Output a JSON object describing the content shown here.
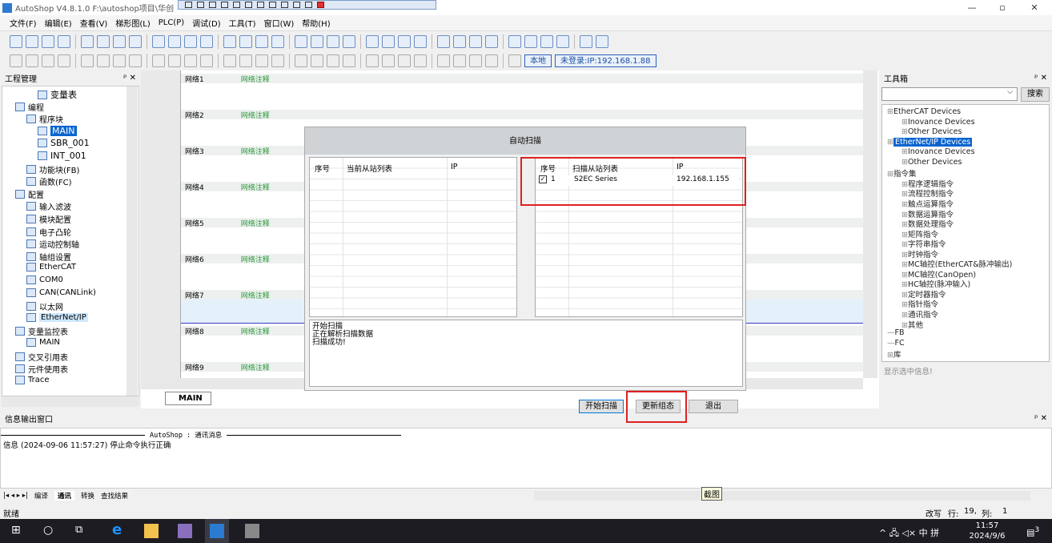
{
  "titlebar": {
    "title": "AutoShop V4.8.1.0  F:\\autoshop项目\\华创",
    "minimize": "—",
    "maximize": "▫",
    "close": "✕"
  },
  "menu": [
    "文件(F)",
    "编辑(E)",
    "查看(V)",
    "梯形图(L)",
    "PLC(P)",
    "调试(D)",
    "工具(T)",
    "窗口(W)",
    "帮助(H)"
  ],
  "toolbar": {
    "local_label": "本地",
    "login_label": "未登录:IP:192.168.1.88"
  },
  "left_panel": {
    "title": "工程管理",
    "items": [
      {
        "label": "变量表",
        "indent": 4
      },
      {
        "label": "编程",
        "indent": 2
      },
      {
        "label": "程序块",
        "indent": 3
      },
      {
        "label": "MAIN",
        "indent": 4,
        "selected": true
      },
      {
        "label": "SBR_001",
        "indent": 4
      },
      {
        "label": "INT_001",
        "indent": 4
      },
      {
        "label": "功能块(FB)",
        "indent": 3
      },
      {
        "label": "函数(FC)",
        "indent": 3
      },
      {
        "label": "配置",
        "indent": 2
      },
      {
        "label": "输入滤波",
        "indent": 3
      },
      {
        "label": "模块配置",
        "indent": 3
      },
      {
        "label": "电子凸轮",
        "indent": 3
      },
      {
        "label": "运动控制轴",
        "indent": 3
      },
      {
        "label": "轴组设置",
        "indent": 3
      },
      {
        "label": "EtherCAT",
        "indent": 3
      },
      {
        "label": "COM0",
        "indent": 3
      },
      {
        "label": "CAN(CANLink)",
        "indent": 3
      },
      {
        "label": "以太网",
        "indent": 3
      },
      {
        "label": "EtherNet/IP",
        "indent": 3,
        "highlight": true
      },
      {
        "label": "变量监控表",
        "indent": 2
      },
      {
        "label": "MAIN",
        "indent": 3
      },
      {
        "label": "交叉引用表",
        "indent": 2
      },
      {
        "label": "元件使用表",
        "indent": 2
      },
      {
        "label": "Trace",
        "indent": 2
      }
    ]
  },
  "editor": {
    "networks": [
      {
        "label": "网络1",
        "comment": "网络注释"
      },
      {
        "label": "网络2",
        "comment": "网络注释"
      },
      {
        "label": "网络3",
        "comment": "网络注释"
      },
      {
        "label": "网络4",
        "comment": "网络注释"
      },
      {
        "label": "网络5",
        "comment": "网络注释"
      },
      {
        "label": "网络6",
        "comment": "网络注释"
      },
      {
        "label": "网络7",
        "comment": "网络注释"
      },
      {
        "label": "网络8",
        "comment": "网络注释"
      },
      {
        "label": "网络9",
        "comment": "网络注释"
      }
    ],
    "tab": "MAIN"
  },
  "right_panel": {
    "title": "工具箱",
    "search_button": "搜索",
    "search_value": "",
    "info": "显示选中信息!",
    "tree": [
      {
        "label": "EtherCAT Devices",
        "level": 0
      },
      {
        "label": "Inovance Devices",
        "level": 1
      },
      {
        "label": "Other Devices",
        "level": 1
      },
      {
        "label": "EtherNet/IP Devices",
        "level": 0,
        "selected": true
      },
      {
        "label": "Inovance Devices",
        "level": 1
      },
      {
        "label": "Other Devices",
        "level": 1
      },
      {
        "label": "指令集",
        "level": 0
      },
      {
        "label": "程序逻辑指令",
        "level": 1
      },
      {
        "label": "流程控制指令",
        "level": 1
      },
      {
        "label": "触点运算指令",
        "level": 1
      },
      {
        "label": "数据运算指令",
        "level": 1
      },
      {
        "label": "数据处理指令",
        "level": 1
      },
      {
        "label": "矩阵指令",
        "level": 1
      },
      {
        "label": "字符串指令",
        "level": 1
      },
      {
        "label": "时钟指令",
        "level": 1
      },
      {
        "label": "MC轴控(EtherCAT&脉冲输出)",
        "level": 1
      },
      {
        "label": "MC轴控(CanOpen)",
        "level": 1
      },
      {
        "label": "HC轴控(脉冲输入)",
        "level": 1
      },
      {
        "label": "定时器指令",
        "level": 1
      },
      {
        "label": "指针指令",
        "level": 1
      },
      {
        "label": "通讯指令",
        "level": 1
      },
      {
        "label": "其他",
        "level": 1
      },
      {
        "label": "FB",
        "level": 0
      },
      {
        "label": "FC",
        "level": 0
      },
      {
        "label": "库",
        "level": 0
      }
    ]
  },
  "dialog": {
    "title": "自动扫描",
    "current_table": {
      "headers": [
        "序号",
        "当前从站列表",
        "IP"
      ],
      "rows": []
    },
    "scan_table": {
      "headers": [
        "序号",
        "扫描从站列表",
        "IP"
      ],
      "rows": [
        {
          "checked": true,
          "index": "1",
          "name": "S2EC Series",
          "ip": "192.168.1.155"
        }
      ]
    },
    "log": [
      "开始扫描",
      "正在解析扫描数据",
      "扫描成功!"
    ],
    "buttons": {
      "start": "开始扫描",
      "update": "更新组态",
      "exit": "退出"
    }
  },
  "output": {
    "title": "信息输出窗口",
    "header": "AutoShop : 通讯消息",
    "message": "信息  (2024-09-06 11:57:27)  停止命令执行正确",
    "tabs": [
      "编译",
      "通讯",
      "转换",
      "查找结果"
    ],
    "active_tab": "通讯",
    "tooltip": "截图"
  },
  "statusbar": {
    "left": "就绪",
    "mode": "改写",
    "row_label": "行:",
    "row": "19,",
    "col_label": "列:",
    "col": "1"
  },
  "taskbar": {
    "time": "11:57",
    "date": "2024/9/6",
    "tray": "^ 🖧 ◁× 中 拼",
    "notifications": "3"
  },
  "colors": {
    "accent": "#0a64d0",
    "highlight_box": "#e02020",
    "comment": "#2b9a3a"
  }
}
